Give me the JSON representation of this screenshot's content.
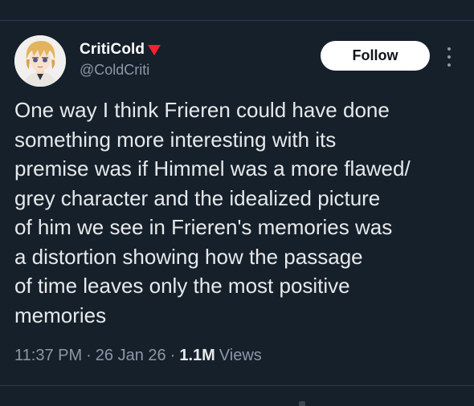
{
  "author": {
    "display_name": "CritiCold",
    "handle": "@ColdCriti",
    "badge": "red-down-triangle-icon",
    "avatar": "anime-avatar-blond-hair"
  },
  "follow_label": "Follow",
  "more_icon": "more-options-icon",
  "tweet": {
    "lines": [
      "One way I think Frieren could have done",
      "something more interesting with its",
      "premise was if Himmel was a more flawed/",
      "grey character and the idealized picture",
      "of him we see in Frieren's memories was",
      "a distortion showing how the passage",
      "of time leaves only the most positive",
      "memories"
    ]
  },
  "meta": {
    "time": "11:37 PM",
    "separator": "·",
    "date": "26 Jan 26",
    "views_count": "1.1M",
    "views_label": "Views"
  },
  "colors": {
    "background": "#15202b",
    "text_primary": "#e7e9ea",
    "text_secondary": "#8b98a5",
    "badge": "#f4212e",
    "follow_bg": "#ffffff"
  }
}
